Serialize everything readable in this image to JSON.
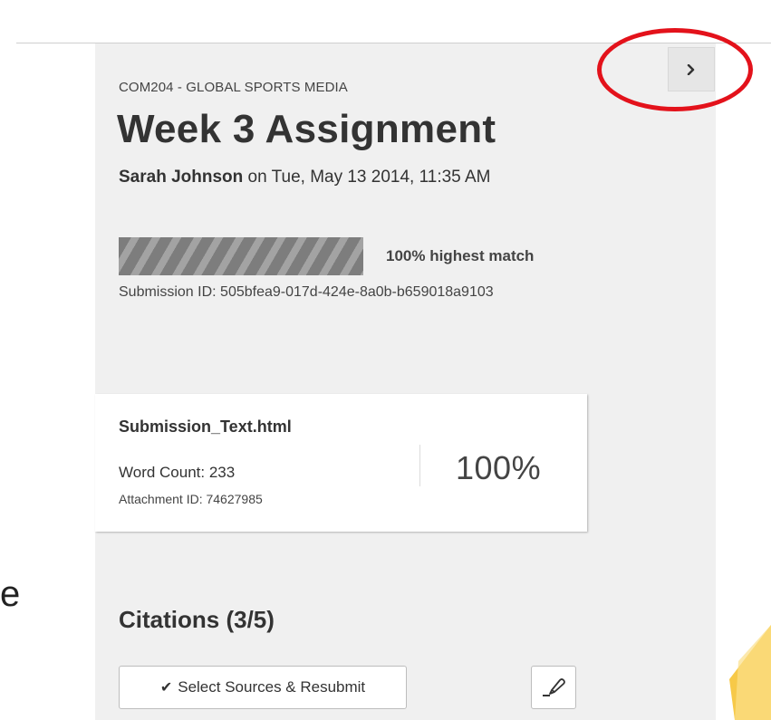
{
  "header": {
    "course": "COM204 - GLOBAL SPORTS MEDIA",
    "title": "Week 3 Assignment",
    "author": "Sarah Johnson",
    "date_text": " on Tue, May 13 2014, 11:35 AM"
  },
  "match": {
    "label": "100% highest match",
    "fraction": 1.0
  },
  "submission": {
    "id_text": "Submission ID: 505bfea9-017d-424e-8a0b-b659018a9103"
  },
  "file_card": {
    "filename": "Submission_Text.html",
    "word_count": "Word Count: 233",
    "attachment_id": "Attachment ID: 74627985",
    "percent": "100%"
  },
  "citations": {
    "heading": "Citations (3/5)",
    "resubmit_label": "Select Sources & Resubmit",
    "check_glyph": "✔"
  },
  "toolbar": {
    "collapse_icon": "chevron-right-icon",
    "highlighter_icon": "highlighter-icon"
  },
  "background": {
    "stray_letter": "e"
  },
  "colors": {
    "annotation_red": "#e3121b",
    "panel_bg": "#f0f0f0",
    "accent_yellow": "#f7c948"
  }
}
